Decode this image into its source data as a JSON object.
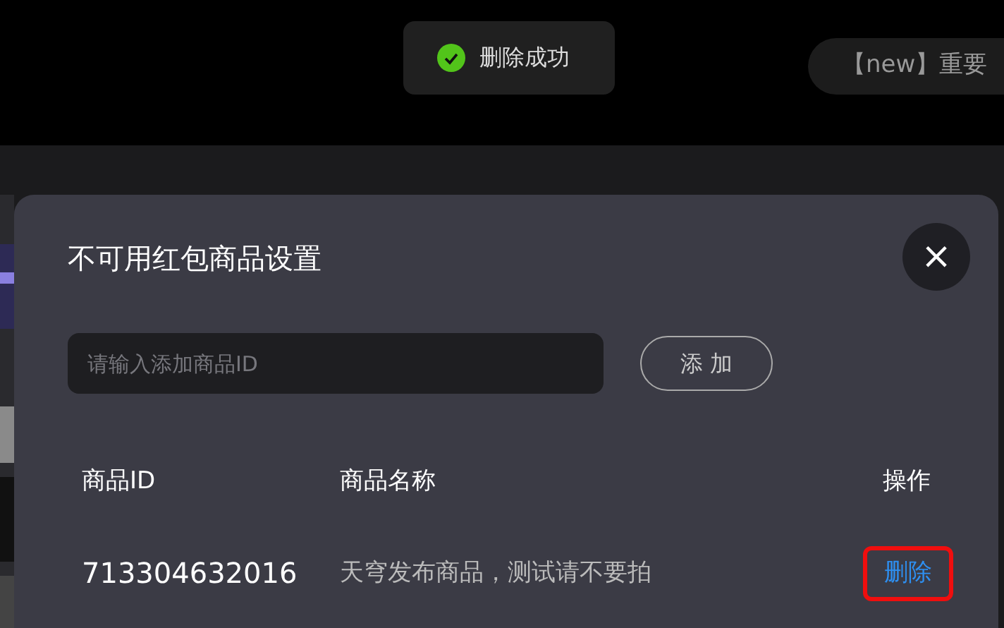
{
  "toast": {
    "kind": "success",
    "message": "删除成功"
  },
  "notice_pill": {
    "text": "【new】重要"
  },
  "dialog": {
    "title": "不可用红包商品设置",
    "close_label": "×",
    "input": {
      "placeholder": "请输入添加商品ID"
    },
    "add_button": "添 加",
    "table": {
      "columns": [
        "商品ID",
        "商品名称",
        "操作"
      ],
      "rows": [
        {
          "id": "713304632016",
          "name": "天穹发布商品，测试请不要拍",
          "action": "删除",
          "highlighted": true
        }
      ]
    }
  }
}
